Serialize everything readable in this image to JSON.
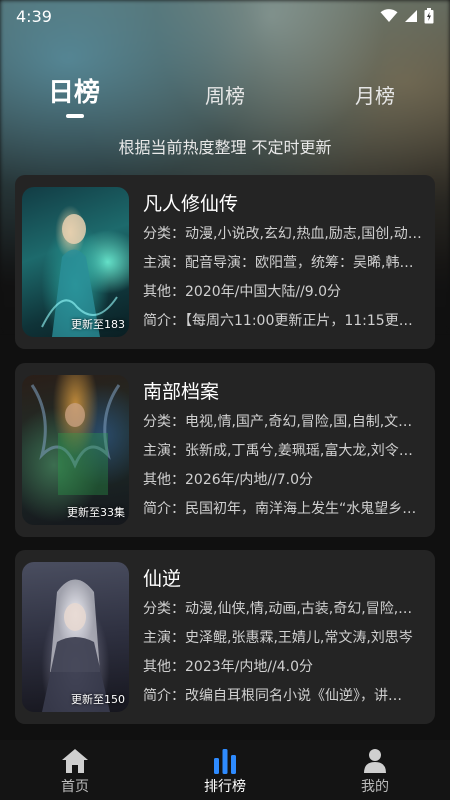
{
  "status": {
    "time": "4:39"
  },
  "tabs": [
    {
      "label": "日榜",
      "active": true
    },
    {
      "label": "周榜",
      "active": false
    },
    {
      "label": "月榜",
      "active": false
    }
  ],
  "subtitle": "根据当前热度整理 不定时更新",
  "colors": {
    "accent": "#2e8bff",
    "card_bg": "#242424"
  },
  "cards": [
    {
      "title": "凡人修仙传",
      "update": "更新至183",
      "category": "分类：动漫,小说改,玄幻,热血,励志,国创,动…",
      "cast": "主演：配音导演：欧阳萱，统筹：吴晞,韩立…",
      "other": "其他：2020年/中国大陆//9.0分",
      "intro": "简介：【每周六11:00更新正片，11:15更…"
    },
    {
      "title": "南部档案",
      "update": "更新至33集",
      "category": "分类：电视,情,国产,奇幻,冒险,国,自制,文学…",
      "cast": "主演：张新成,丁禹兮,姜珮瑶,富大龙,刘令姿…",
      "other": "其他：2026年/内地//7.0分",
      "intro": "简介：民国初年，南洋海上发生“水鬼望乡”…"
    },
    {
      "title": "仙逆",
      "update": "更新至150",
      "category": "分类：动漫,仙侠,情,动画,古装,奇幻,冒险,国…",
      "cast": "主演：史泽鲲,张惠霖,王婧儿,常文涛,刘思岑",
      "other": "其他：2023年/内地//4.0分",
      "intro": "简介：改编自耳根同名小说《仙逆》，讲…"
    }
  ],
  "nav": [
    {
      "label": "首页",
      "icon": "home-icon",
      "active": false
    },
    {
      "label": "排行榜",
      "icon": "ranking-icon",
      "active": true
    },
    {
      "label": "我的",
      "icon": "user-icon",
      "active": false
    }
  ]
}
